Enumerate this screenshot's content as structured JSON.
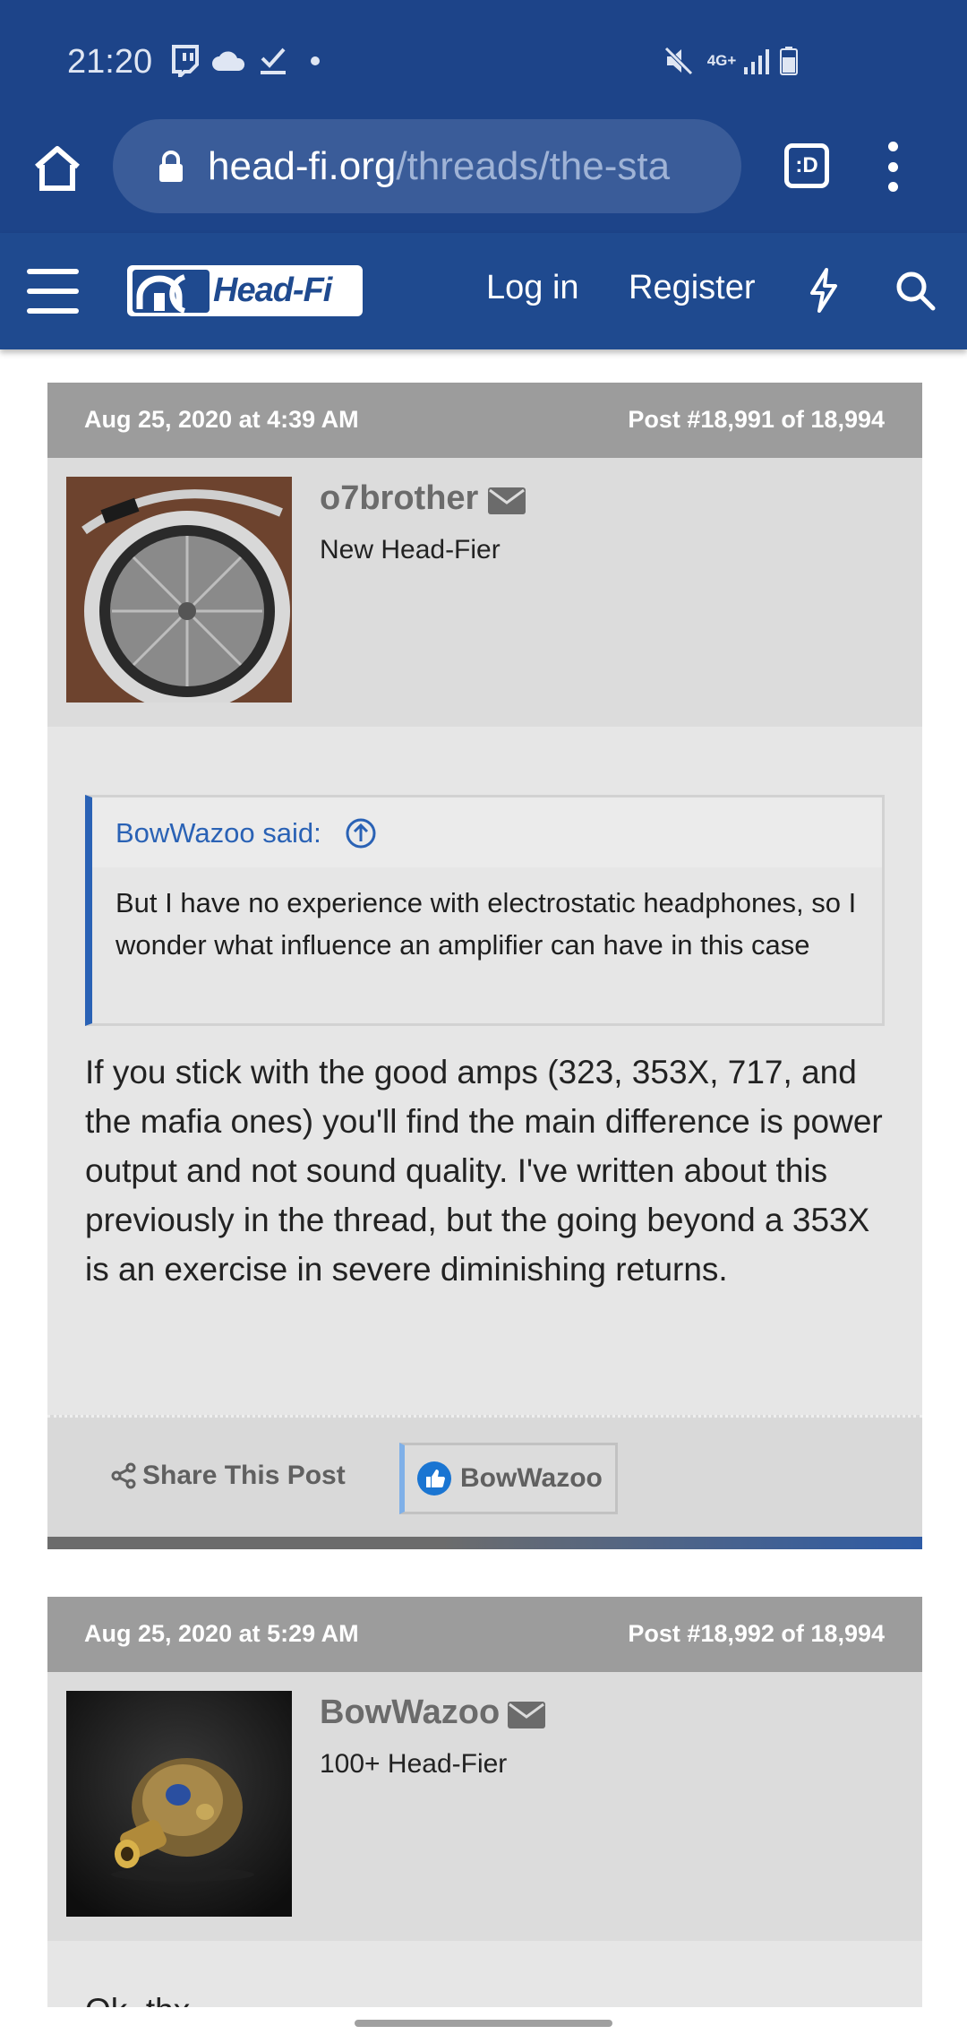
{
  "status_bar": {
    "time": "21:20",
    "network_label": "4G+"
  },
  "browser": {
    "url_host": "head-fi.org",
    "url_path": "/threads/the-sta",
    "tab_switcher_label": ":D"
  },
  "site": {
    "logo_text": "Head-Fi",
    "nav": {
      "login": "Log in",
      "register": "Register"
    },
    "accent_color": "#1f4a8f"
  },
  "posts": [
    {
      "date": "Aug 25, 2020 at 4:39 AM",
      "post_number": "Post #18,991 of 18,994",
      "username": "o7brother",
      "user_title": "New Head-Fier",
      "quote": {
        "author": "BowWazoo said:",
        "text": "But I have no experience with electrostatic headphones, so I wonder what influence an amplifier can have in this case"
      },
      "message": "If you stick with the good amps (323, 353X, 717, and the mafia ones) you'll find the main difference is power output and not sound quality. I've written about this previously in the thread, but the going beyond a 353X is an exercise in severe diminishing returns.",
      "share_label": "Share This Post",
      "liked_by": "BowWazoo"
    },
    {
      "date": "Aug 25, 2020 at 5:29 AM",
      "post_number": "Post #18,992 of 18,994",
      "username": "BowWazoo",
      "user_title": "100+ Head-Fier",
      "message": "Ok, thx"
    }
  ]
}
